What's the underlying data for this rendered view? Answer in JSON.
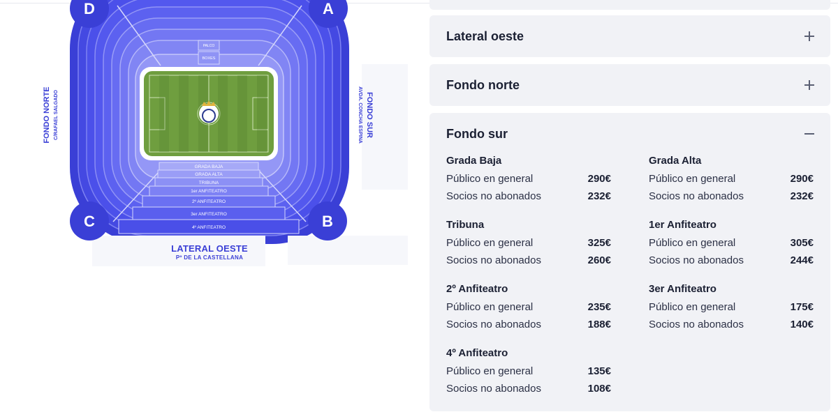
{
  "stadium": {
    "gates": {
      "a": "A",
      "b": "B",
      "c": "C",
      "d": "D"
    },
    "side_labels": {
      "fondo_norte": "FONDO NORTE",
      "fondo_norte_sub": "C/RAFAEL SALGADO",
      "fondo_sur": "FONDO SUR",
      "fondo_sur_sub": "AVDA. CONCHA ESPINA",
      "lateral_oeste": "LATERAL OESTE",
      "lateral_oeste_sub": "Pº DE LA CASTELLANA"
    },
    "top_tiers": {
      "palco": "PALCO",
      "boxes": "BOXES"
    },
    "bottom_tiers": [
      "GRADA BAJA",
      "GRADA ALTA",
      "TRIBUNA",
      "1er ANFITEATRO",
      "2º ANFITEATRO",
      "3er ANFITEATRO",
      "4º ANFITEATRO"
    ],
    "colors": {
      "primary": "#3a3fd6",
      "ring_dark": "#4a4fe8",
      "ring_light": "#8f93f5",
      "pitch": "#6f9e3f"
    }
  },
  "accordion": [
    {
      "title": "Lateral oeste",
      "expanded": false,
      "toggle_icon": "plus-icon"
    },
    {
      "title": "Fondo norte",
      "expanded": false,
      "toggle_icon": "plus-icon"
    },
    {
      "title": "Fondo sur",
      "expanded": true,
      "toggle_icon": "minus-icon",
      "sections": [
        {
          "name": "Grada Baja",
          "rows": [
            {
              "label": "Público en general",
              "price": "290€"
            },
            {
              "label": "Socios no abonados",
              "price": "232€"
            }
          ]
        },
        {
          "name": "Grada Alta",
          "rows": [
            {
              "label": "Público en general",
              "price": "290€"
            },
            {
              "label": "Socios no abonados",
              "price": "232€"
            }
          ]
        },
        {
          "name": "Tribuna",
          "rows": [
            {
              "label": "Público en general",
              "price": "325€"
            },
            {
              "label": "Socios no abonados",
              "price": "260€"
            }
          ]
        },
        {
          "name": "1er Anfiteatro",
          "rows": [
            {
              "label": "Público en general",
              "price": "305€"
            },
            {
              "label": "Socios no abonados",
              "price": "244€"
            }
          ]
        },
        {
          "name": "2º Anfiteatro",
          "rows": [
            {
              "label": "Público en general",
              "price": "235€"
            },
            {
              "label": "Socios no abonados",
              "price": "188€"
            }
          ]
        },
        {
          "name": "3er Anfiteatro",
          "rows": [
            {
              "label": "Público en general",
              "price": "175€"
            },
            {
              "label": "Socios no abonados",
              "price": "140€"
            }
          ]
        },
        {
          "name": "4º Anfiteatro",
          "rows": [
            {
              "label": "Público en general",
              "price": "135€"
            },
            {
              "label": "Socios no abonados",
              "price": "108€"
            }
          ]
        }
      ]
    }
  ]
}
